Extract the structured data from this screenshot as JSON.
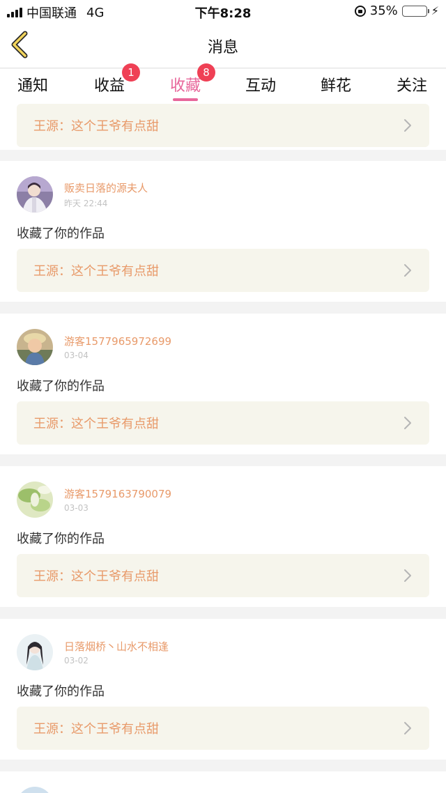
{
  "status_bar": {
    "carrier": "中国联通",
    "network": "4G",
    "time": "下午8:28",
    "battery_text": "35%",
    "battery_level": 0.35
  },
  "nav": {
    "title": "消息"
  },
  "tabs": [
    {
      "label": "通知"
    },
    {
      "label": "收益",
      "badge": "1"
    },
    {
      "label": "收藏",
      "badge": "8"
    },
    {
      "label": "互动"
    },
    {
      "label": "鲜花"
    },
    {
      "label": "关注"
    }
  ],
  "top_partial": {
    "ref_text": "王源：这个王爷有点甜"
  },
  "items": [
    {
      "name": "贩卖日落的源夫人",
      "time": "昨天 22:44",
      "action": "收藏了你的作品",
      "ref_text": "王源：这个王爷有点甜"
    },
    {
      "name": "游客1577965972699",
      "time": "03-04",
      "action": "收藏了你的作品",
      "ref_text": "王源：这个王爷有点甜"
    },
    {
      "name": "游客1579163790079",
      "time": "03-03",
      "action": "收藏了你的作品",
      "ref_text": "王源：这个王爷有点甜"
    },
    {
      "name": "日落烟桥丶山水不相逢",
      "time": "03-02",
      "action": "收藏了你的作品",
      "ref_text": "王源：这个王爷有点甜"
    }
  ],
  "colors": {
    "accent": "#e8679b",
    "badge": "#ef4055",
    "name": "#e89a6a",
    "ref_bg": "#f6f5ec"
  }
}
